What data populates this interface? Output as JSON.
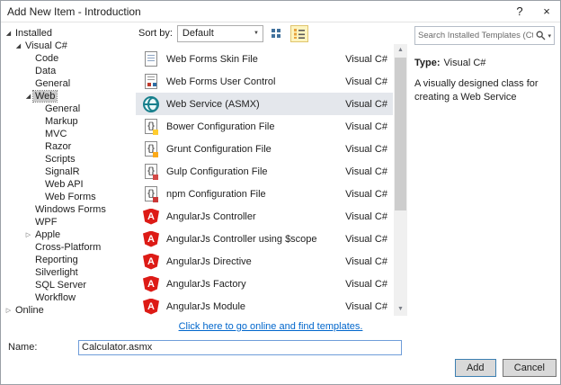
{
  "colors": {
    "accent_blue": "#3c7fb1",
    "link_blue": "#0066cc",
    "angular_red": "#dd1b16",
    "selection_gray": "#e4e7ec",
    "tree_selection_gray": "#cacaca",
    "toolbar_active_bg": "#fdf4bf",
    "toolbar_active_border": "#e0c56e"
  },
  "window": {
    "title": "Add New Item - Introduction",
    "help": "?",
    "close": "×"
  },
  "toolbar": {
    "sort_label": "Sort by:",
    "sort_value": "Default"
  },
  "search": {
    "placeholder": "Search Installed Templates (Ctrl+E)"
  },
  "icons": {
    "sort_caret": "chevron-down-icon",
    "view_medium": "medium-icons-view-icon",
    "view_list": "list-view-icon",
    "search": "search-icon",
    "scroll_up": "scroll-up-arrow-icon",
    "scroll_down": "scroll-down-arrow-icon"
  },
  "tree": {
    "items": [
      {
        "label": "Installed",
        "level": 0,
        "arrow": "expanded"
      },
      {
        "label": "Visual C#",
        "level": 1,
        "arrow": "expanded"
      },
      {
        "label": "Code",
        "level": 2
      },
      {
        "label": "Data",
        "level": 2
      },
      {
        "label": "General",
        "level": 2
      },
      {
        "label": "Web",
        "level": 2,
        "arrow": "expanded",
        "selected": true
      },
      {
        "label": "General",
        "level": 3
      },
      {
        "label": "Markup",
        "level": 3
      },
      {
        "label": "MVC",
        "level": 3
      },
      {
        "label": "Razor",
        "level": 3
      },
      {
        "label": "Scripts",
        "level": 3
      },
      {
        "label": "SignalR",
        "level": 3
      },
      {
        "label": "Web API",
        "level": 3
      },
      {
        "label": "Web Forms",
        "level": 3
      },
      {
        "label": "Windows Forms",
        "level": 2
      },
      {
        "label": "WPF",
        "level": 2
      },
      {
        "label": "Apple",
        "level": 2,
        "arrow": "collapsed"
      },
      {
        "label": "Cross-Platform",
        "level": 2
      },
      {
        "label": "Reporting",
        "level": 2
      },
      {
        "label": "Silverlight",
        "level": 2
      },
      {
        "label": "SQL Server",
        "level": 2
      },
      {
        "label": "Workflow",
        "level": 2
      },
      {
        "label": "Online",
        "level": 0,
        "arrow": "collapsed"
      }
    ]
  },
  "templates": {
    "items": [
      {
        "name": "Web Forms Skin File",
        "language": "Visual C#",
        "icon": "web-forms-skin-icon"
      },
      {
        "name": "Web Forms User Control",
        "language": "Visual C#",
        "icon": "web-forms-user-control-icon"
      },
      {
        "name": "Web Service (ASMX)",
        "language": "Visual C#",
        "icon": "web-service-globe-icon",
        "selected": true
      },
      {
        "name": "Bower Configuration File",
        "language": "Visual C#",
        "icon": "bower-config-icon"
      },
      {
        "name": "Grunt Configuration File",
        "language": "Visual C#",
        "icon": "grunt-config-icon"
      },
      {
        "name": "Gulp Configuration File",
        "language": "Visual C#",
        "icon": "gulp-config-icon"
      },
      {
        "name": "npm Configuration File",
        "language": "Visual C#",
        "icon": "npm-config-icon"
      },
      {
        "name": "AngularJs Controller",
        "language": "Visual C#",
        "icon": "angularjs-shield-icon"
      },
      {
        "name": "AngularJs Controller using $scope",
        "language": "Visual C#",
        "icon": "angularjs-shield-icon"
      },
      {
        "name": "AngularJs Directive",
        "language": "Visual C#",
        "icon": "angularjs-shield-icon"
      },
      {
        "name": "AngularJs Factory",
        "language": "Visual C#",
        "icon": "angularjs-shield-icon"
      },
      {
        "name": "AngularJs Module",
        "language": "Visual C#",
        "icon": "angularjs-shield-icon"
      }
    ]
  },
  "info": {
    "type_label": "Type:",
    "type_value": "Visual C#",
    "description": "A visually designed class for creating a Web Service"
  },
  "link": {
    "text": "Click here to go online and find templates."
  },
  "name_row": {
    "label": "Name:",
    "value": "Calculator.asmx"
  },
  "actions": {
    "add": "Add",
    "cancel": "Cancel"
  }
}
